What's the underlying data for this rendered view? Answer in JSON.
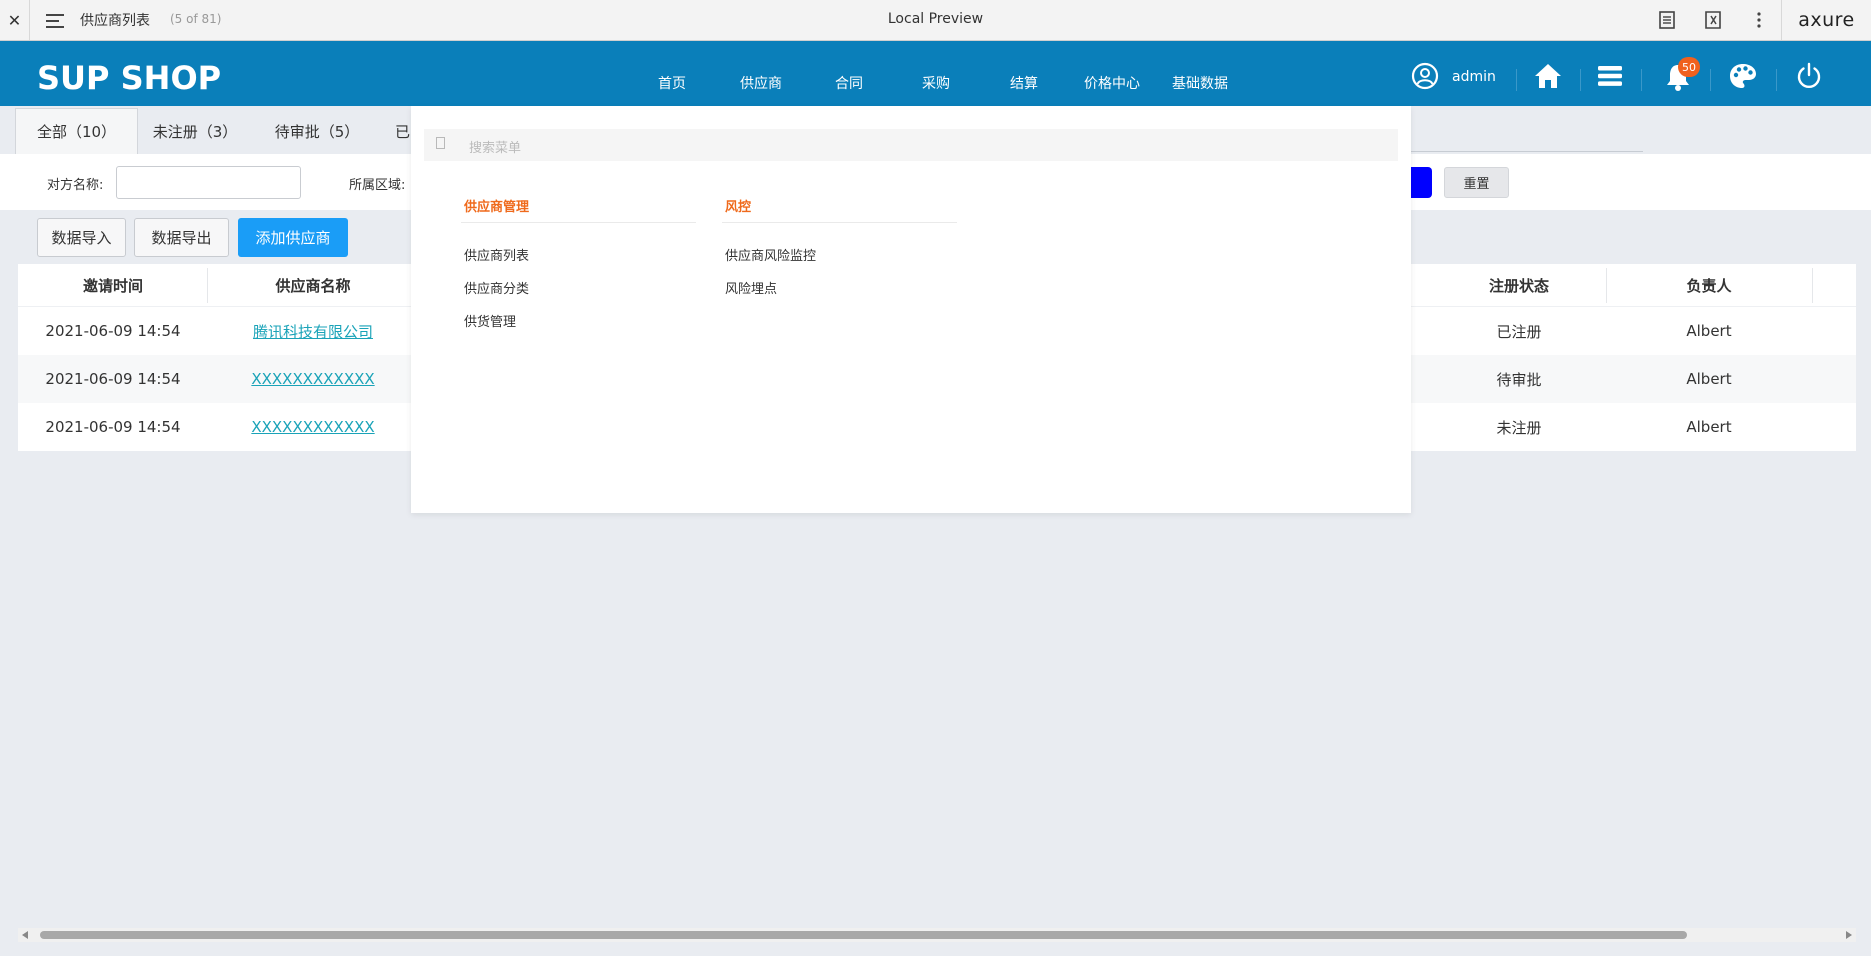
{
  "preview_bar": {
    "close": "✕",
    "page_name": "供应商列表",
    "page_count": "(5 of 81)",
    "title": "Local Preview",
    "logo": "axure"
  },
  "header": {
    "brand": "SUP SHOP",
    "nav": [
      "首页",
      "供应商",
      "合同",
      "采购",
      "结算",
      "价格中心",
      "基础数据"
    ],
    "user": "admin",
    "notification_count": "50",
    "icons": [
      "user-circle-icon",
      "home-icon",
      "menu-icon",
      "bell-icon",
      "palette-icon",
      "power-icon"
    ]
  },
  "tabs": [
    {
      "label": "全部（10）"
    },
    {
      "label": "未注册（3）"
    },
    {
      "label": "待审批（5）"
    },
    {
      "label": "已"
    }
  ],
  "filter": {
    "name_label": "对方名称:",
    "name_value": "",
    "region_label": "所属区域:",
    "reset": "重置"
  },
  "actions": {
    "import": "数据导入",
    "export": "数据导出",
    "add": "添加供应商"
  },
  "table": {
    "columns": [
      "邀请时间",
      "供应商名称",
      "注册状态",
      "负责人"
    ],
    "rows": [
      {
        "time": "2021-06-09 14:54",
        "name": "腾讯科技有限公司",
        "status": "已注册",
        "owner": "Albert"
      },
      {
        "time": "2021-06-09 14:54",
        "name": "XXXXXXXXXXXX",
        "status": "待审批",
        "owner": "Albert"
      },
      {
        "time": "2021-06-09 14:54",
        "name": "XXXXXXXXXXXX",
        "status": "未注册",
        "owner": "Albert"
      }
    ]
  },
  "dropdown": {
    "search_placeholder": "搜索菜单",
    "groups": [
      {
        "title": "供应商管理",
        "items": [
          "供应商列表",
          "供应商分类",
          "供货管理"
        ]
      },
      {
        "title": "风控",
        "items": [
          "供应商风险监控",
          "风险埋点"
        ]
      }
    ]
  },
  "colors": {
    "header_bg": "#0a7fba",
    "primary_button": "#1a9df7",
    "query_button": "#0000ff",
    "accent_orange": "#ef6a1c",
    "link": "#1aa3b8",
    "badge": "#f0611e"
  }
}
